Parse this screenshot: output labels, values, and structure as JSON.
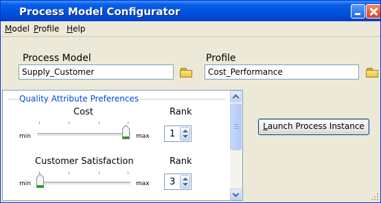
{
  "window": {
    "title": "Process Model Configurator"
  },
  "menu": [
    {
      "accel": "M",
      "rest": "odel"
    },
    {
      "accel": "P",
      "rest": "rofile"
    },
    {
      "accel": "H",
      "rest": "elp"
    }
  ],
  "process_model": {
    "label": "Process Model",
    "value": "Supply_Customer",
    "browse_icon": "folder-icon"
  },
  "profile": {
    "label": "Profile",
    "value": "Cost_Performance",
    "browse_icon": "folder-icon"
  },
  "preferences": {
    "group_title": "Quality Attribute Preferences",
    "items": [
      {
        "name": "Cost",
        "rank_label": "Rank",
        "min_label": "min",
        "max_label": "max",
        "slider_value": 1.0,
        "rank": "1"
      },
      {
        "name": "Customer Satisfaction",
        "rank_label": "Rank",
        "min_label": "min",
        "max_label": "max",
        "slider_value": 0.0,
        "rank": "3"
      }
    ]
  },
  "launch_button": {
    "accel": "L",
    "rest": "aunch Process Instance"
  },
  "colors": {
    "titlebar": "#0054e3",
    "group_title": "#0046d5",
    "thumb_accent": "#2c9a2c"
  }
}
